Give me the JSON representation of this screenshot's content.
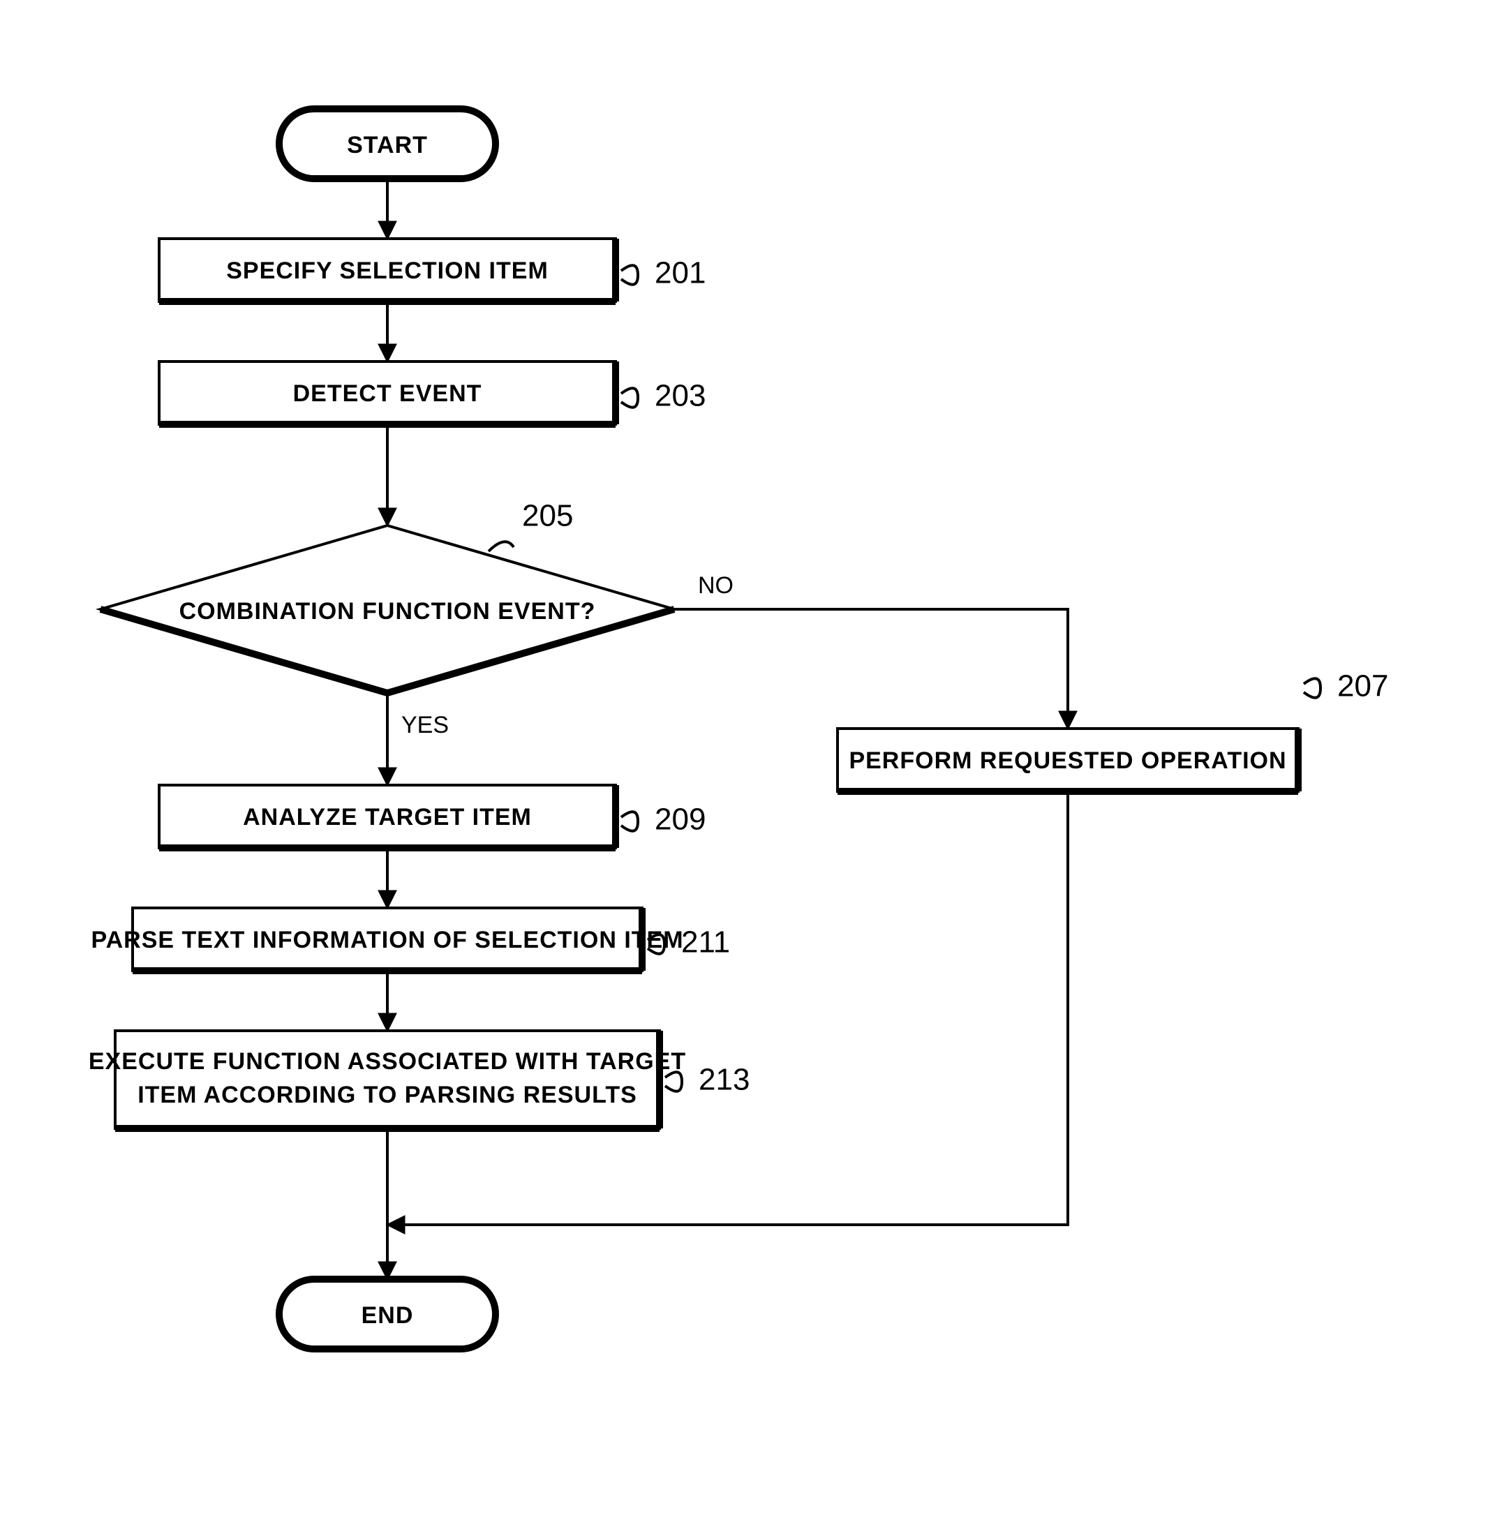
{
  "chart_data": {
    "type": "flowchart",
    "nodes": [
      {
        "id": "start",
        "kind": "terminator",
        "label": "START"
      },
      {
        "id": "n201",
        "kind": "process",
        "label": "SPECIFY SELECTION ITEM",
        "ref": "201"
      },
      {
        "id": "n203",
        "kind": "process",
        "label": "DETECT EVENT",
        "ref": "203"
      },
      {
        "id": "n205",
        "kind": "decision",
        "label": "COMBINATION FUNCTION EVENT?",
        "ref": "205"
      },
      {
        "id": "n207",
        "kind": "process",
        "label": "PERFORM REQUESTED OPERATION",
        "ref": "207"
      },
      {
        "id": "n209",
        "kind": "process",
        "label": "ANALYZE TARGET ITEM",
        "ref": "209"
      },
      {
        "id": "n211",
        "kind": "process",
        "label": "PARSE TEXT INFORMATION OF SELECTION ITEM",
        "ref": "211"
      },
      {
        "id": "n213",
        "kind": "process",
        "label": "EXECUTE FUNCTION ASSOCIATED WITH TARGET ITEM ACCORDING TO PARSING RESULTS",
        "ref": "213"
      },
      {
        "id": "end",
        "kind": "terminator",
        "label": "END"
      }
    ],
    "edges": [
      {
        "from": "start",
        "to": "n201"
      },
      {
        "from": "n201",
        "to": "n203"
      },
      {
        "from": "n203",
        "to": "n205"
      },
      {
        "from": "n205",
        "to": "n209",
        "label": "YES"
      },
      {
        "from": "n205",
        "to": "n207",
        "label": "NO"
      },
      {
        "from": "n209",
        "to": "n211"
      },
      {
        "from": "n211",
        "to": "n213"
      },
      {
        "from": "n213",
        "to": "end"
      },
      {
        "from": "n207",
        "to": "end"
      }
    ],
    "labels": {
      "yes": "YES",
      "no": "NO"
    }
  }
}
